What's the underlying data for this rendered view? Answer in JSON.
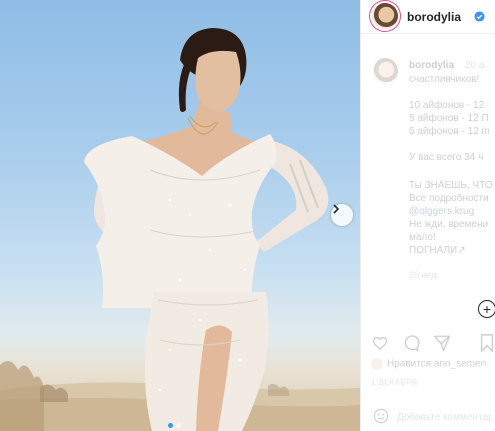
{
  "post": {
    "username": "borodylia",
    "verified_icon": "verified-badge-icon",
    "next_icon": "chevron-right-icon",
    "carousel_dots": 2,
    "active_dot": 0
  },
  "caption": {
    "username": "borodylia",
    "time": "20 a",
    "first_line": "счастливчиков!",
    "lines": [
      "10 айфонов - 12",
      "5 айфонов - 12 П",
      "5 айфонов - 12 m",
      "",
      "У вас всего 34 ч",
      "",
      "Ты ЗНАЕШЬ, ЧТО",
      "Все подробности",
      "@olggers.krug",
      "Не жди, времени",
      "мало!",
      "ПОГНАЛИ↗"
    ],
    "timestamp": "26 нед."
  },
  "footer": {
    "likes_text": "Нравится ann_semen",
    "date": "1 ДЕКАБРЯ",
    "comment_placeholder": "Добавьте комментарий",
    "icons": [
      "heart-icon",
      "comment-icon",
      "share-icon",
      "bookmark-icon",
      "emoji-icon",
      "add-post-icon"
    ]
  },
  "colors": {
    "accent": "#3897f0",
    "text": "#262626",
    "muted": "#8e8e8e",
    "link": "#00376b"
  }
}
